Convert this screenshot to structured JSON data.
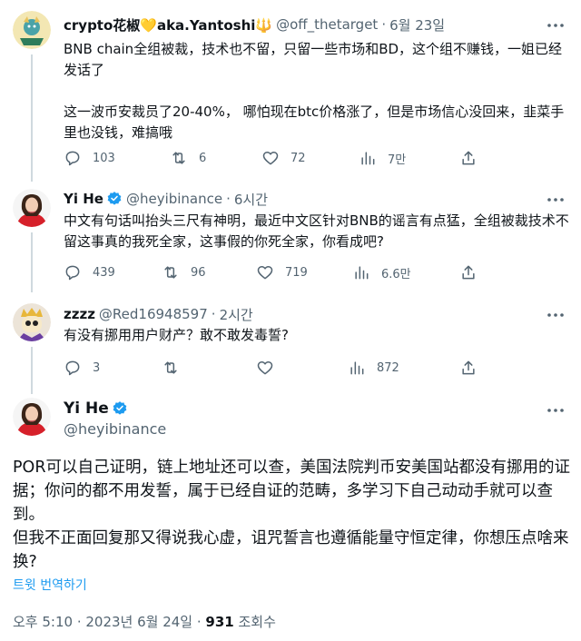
{
  "tweets": [
    {
      "name": "crypto花椒💛aka.Yantoshi🔱",
      "handle": "@off_thetarget",
      "time": "6월 23일",
      "text": [
        "BNB chain全组被裁，技术也不留，只留一些市场和BD，这个组不赚钱，一姐已经发话了",
        "这一波币安裁员了20-40%， 哪怕现在btc价格涨了，但是市场信心没回来，韭菜手里也没钱，难搞哦"
      ],
      "replies": "103",
      "retweets": "6",
      "likes": "72",
      "views": "7만"
    },
    {
      "name": "Yi He",
      "handle": "@heyibinance",
      "time": "6시간",
      "text": [
        "中文有句话叫抬头三尺有神明，最近中文区针对BNB的谣言有点猛，全组被裁技术不留这事真的我死全家，这事假的你死全家，你看成吧?"
      ],
      "replies": "439",
      "retweets": "96",
      "likes": "719",
      "views": "6.6만"
    },
    {
      "name": "zzzz",
      "handle": "@Red16948597",
      "time": "2시간",
      "text": [
        "有没有挪用用户财产？敢不敢发毒誓?"
      ],
      "replies": "3",
      "retweets": "",
      "likes": "",
      "views": "872"
    }
  ],
  "main": {
    "name": "Yi He",
    "handle": "@heyibinance",
    "text": [
      "POR可以自己证明，链上地址还可以查，美国法院判币安美国站都没有挪用的证据；你问的都不用发誓，属于已经自证的范畴，多学习下自己动动手就可以查到。",
      "但我不正面回复那又得说我心虚，诅咒誓言也遵循能量守恒定律，你想压点啥来换?"
    ],
    "translate": "트윗 번역하기",
    "timestamp": "오후 5:10 · 2023년 6월 24일 · ",
    "view_count": "931",
    "view_label": " 조회수"
  },
  "separator": "·",
  "colors": {
    "accent": "#1d9bf0",
    "secondary": "#536471",
    "divider": "#eff3f4"
  }
}
